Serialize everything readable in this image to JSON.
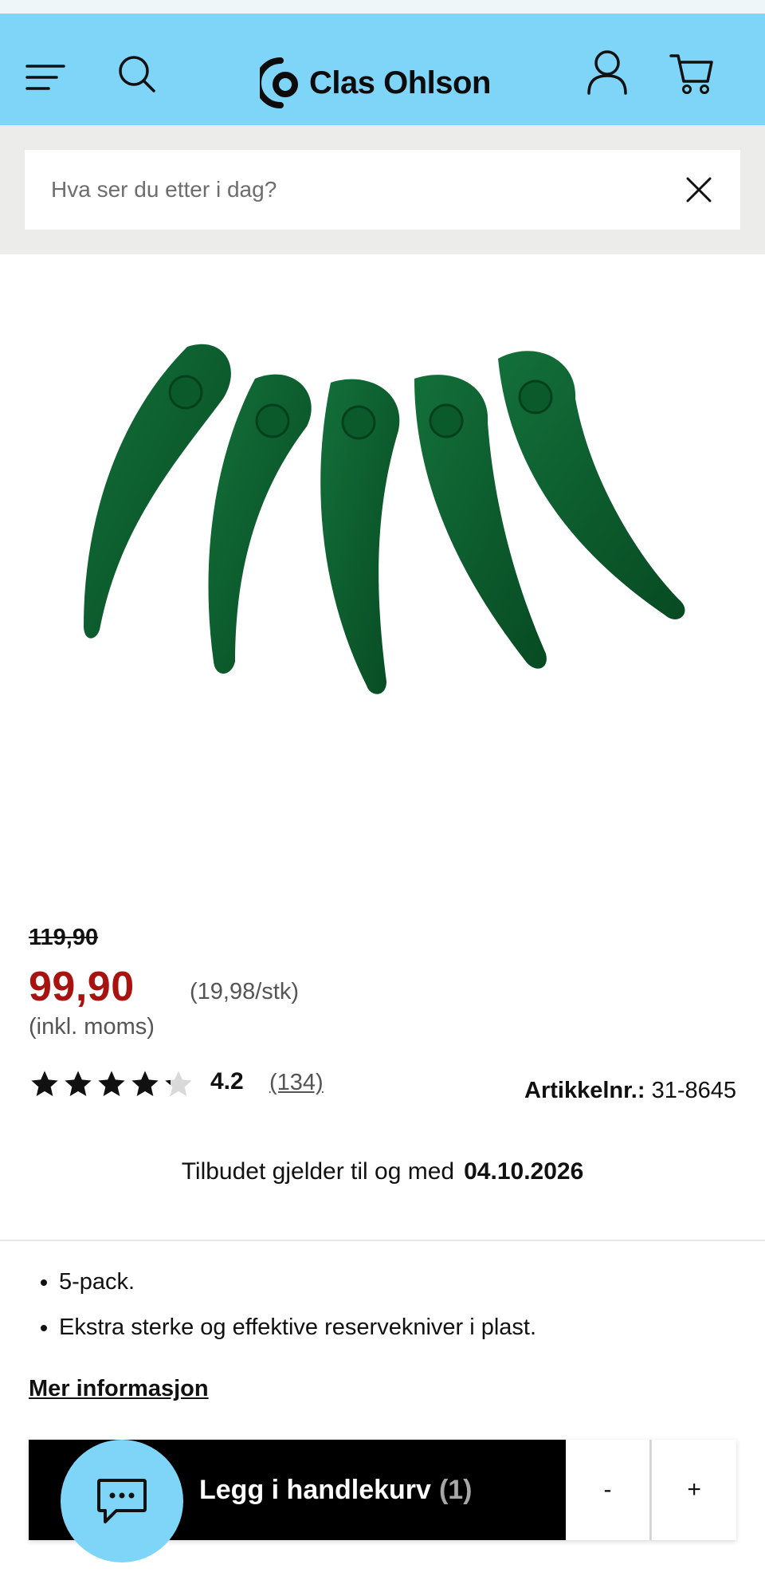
{
  "header": {
    "brand": "Clas Ohlson",
    "icons": [
      "menu-icon",
      "search-icon",
      "account-icon",
      "cart-icon"
    ]
  },
  "search": {
    "placeholder": "Hva ser du etter i dag?",
    "value": ""
  },
  "product": {
    "image_alt_icon": "trimmer-blades-image",
    "old_price": "119,90",
    "price": "99,90",
    "unit_price": "(19,98/stk)",
    "vat_note": "(inkl. moms)",
    "rating": "4.2",
    "rating_value": 4.2,
    "reviews": "(134)",
    "article_label": "Artikkelnr.:",
    "article_number": "31-8645",
    "offer_text": "Tilbudet gjelder til og med",
    "offer_date": "04.10.2026",
    "bullets": [
      "5-pack.",
      "Ekstra sterke og effektive reservekniver i plast."
    ],
    "more_info": "Mer informasjon"
  },
  "cart_bar": {
    "add_label": "Legg i handlekurv",
    "count": "(1)",
    "minus": "-",
    "plus": "+"
  },
  "colors": {
    "header_bg": "#7fd5f8",
    "price": "#a8120f",
    "blade": "#0a5a2c"
  }
}
